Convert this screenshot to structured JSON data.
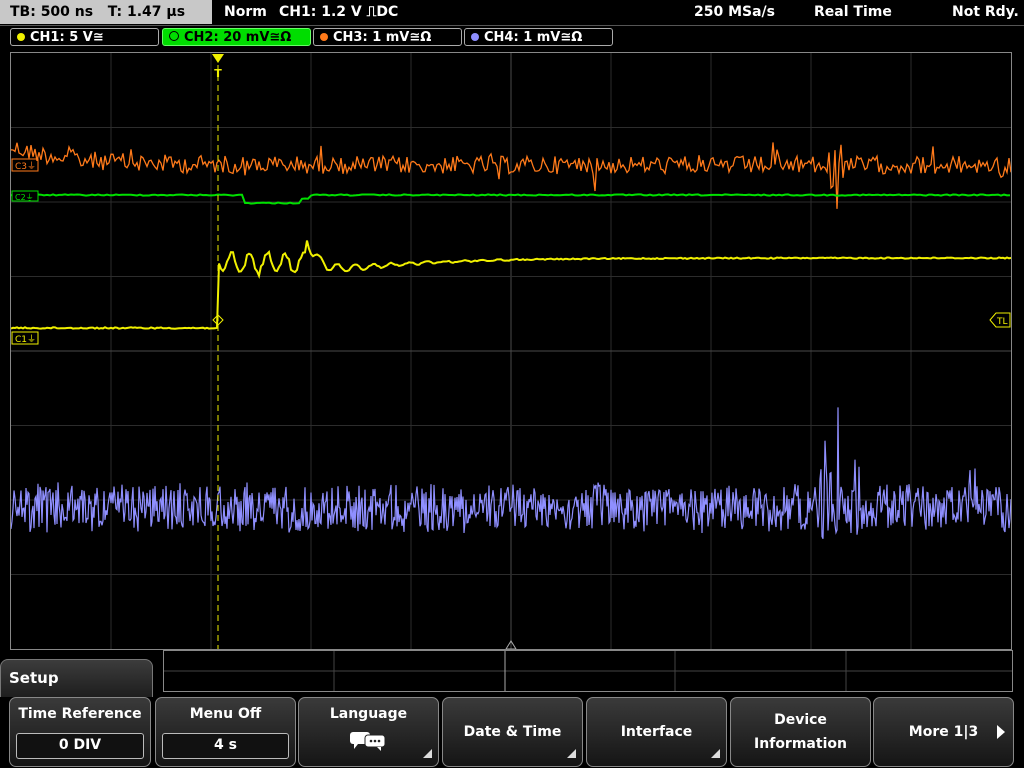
{
  "status": {
    "timebase": "TB: 500 ns",
    "trigger_time": "T: 1.47 µs",
    "mode": "Norm",
    "trigger_setting": "CH1: 1.2 V ⎍DC",
    "sample_rate": "250 MSa/s",
    "acq_mode": "Real Time",
    "state": "Not Rdy."
  },
  "channels": [
    {
      "label": "CH1: 5 V≅",
      "color": "#f0f000"
    },
    {
      "label": "CH2: 20 mV≅Ω",
      "color": "#00e000"
    },
    {
      "label": "CH3: 1 mV≅Ω",
      "color": "#ff7a1a"
    },
    {
      "label": "CH4: 1 mV≅Ω",
      "color": "#8f8fff"
    }
  ],
  "markers": {
    "c3": "C3⏚",
    "c2": "C2⏚",
    "c1": "C1⏚",
    "trigger_level": "TL",
    "trigger_position": "T"
  },
  "menu": {
    "title": "Setup",
    "softkeys": [
      {
        "title": "Time Reference",
        "value": "0 DIV"
      },
      {
        "title": "Menu Off",
        "value": "4 s"
      },
      {
        "title": "Language"
      },
      {
        "title": "Date & Time"
      },
      {
        "title": "Interface"
      },
      {
        "title": "Device",
        "title2": "Information"
      },
      {
        "title": "More 1|3"
      }
    ]
  },
  "icons": {
    "language": "speech-bubbles-icon",
    "submenu": "corner-triangle-icon",
    "next": "right-arrow-icon"
  }
}
